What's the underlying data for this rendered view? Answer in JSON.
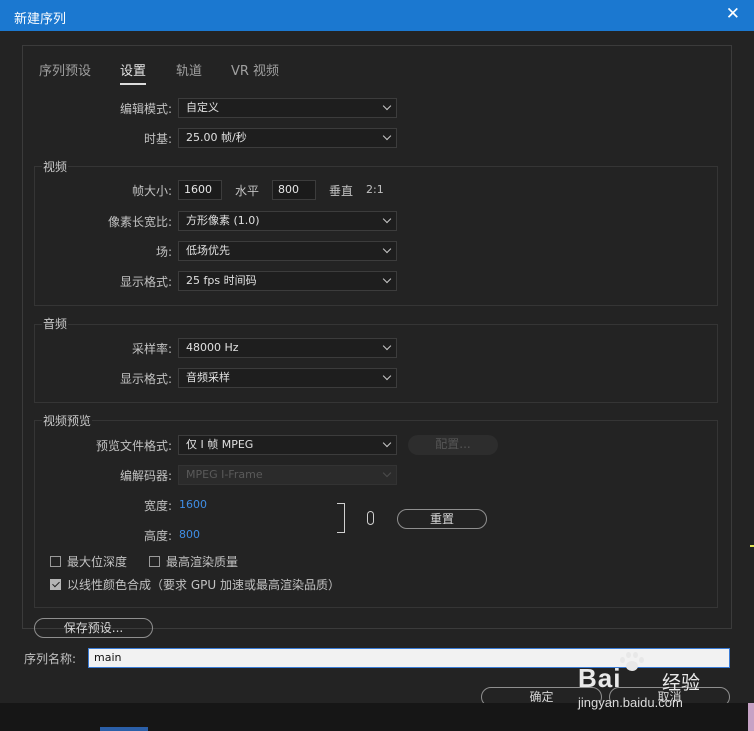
{
  "window": {
    "title": "新建序列",
    "close_icon": "close-icon"
  },
  "tabs": [
    {
      "label": "序列预设",
      "active": false
    },
    {
      "label": "设置",
      "active": true
    },
    {
      "label": "轨道",
      "active": false
    },
    {
      "label": "VR 视频",
      "active": false
    }
  ],
  "general": {
    "editing_mode": {
      "label": "编辑模式:",
      "value": "自定义"
    },
    "timebase": {
      "label": "时基:",
      "value": "25.00  帧/秒"
    }
  },
  "video": {
    "title": "视频",
    "frame_size": {
      "label": "帧大小:",
      "width": "1600",
      "h_label": "水平",
      "height": "800",
      "v_label": "垂直",
      "ratio": "2:1"
    },
    "pixel_aspect": {
      "label": "像素长宽比:",
      "value": "方形像素 (1.0)"
    },
    "fields": {
      "label": "场:",
      "value": "低场优先"
    },
    "display_format": {
      "label": "显示格式:",
      "value": "25 fps 时间码"
    }
  },
  "audio": {
    "title": "音频",
    "sample_rate": {
      "label": "采样率:",
      "value": "48000 Hz"
    },
    "display_format": {
      "label": "显示格式:",
      "value": "音频采样"
    }
  },
  "video_preview": {
    "title": "视频预览",
    "file_format": {
      "label": "预览文件格式:",
      "value": "仅 I 帧 MPEG"
    },
    "configure_label": "配置...",
    "codec": {
      "label": "编解码器:",
      "value": "MPEG I-Frame"
    },
    "width": {
      "label": "宽度:",
      "value": "1600"
    },
    "height": {
      "label": "高度:",
      "value": "800"
    },
    "reset_label": "重置",
    "max_bit_depth": {
      "label": "最大位深度",
      "checked": false
    },
    "max_render_quality": {
      "label": "最高渲染质量",
      "checked": false
    },
    "linear_color": {
      "label": "以线性颜色合成（要求 GPU 加速或最高渲染品质）",
      "checked": true
    }
  },
  "save_preset_label": "保存预设...",
  "sequence_name": {
    "label": "序列名称:",
    "value": "main"
  },
  "ok_label": "确定",
  "cancel_label": "取消",
  "watermark": {
    "brand": "Bai",
    "brand_cn": "经验",
    "url": "jingyan.baidu.com"
  },
  "colors": {
    "titlebar": "#1b78d0",
    "link_value": "#3f8ee6",
    "background": "#232323"
  }
}
